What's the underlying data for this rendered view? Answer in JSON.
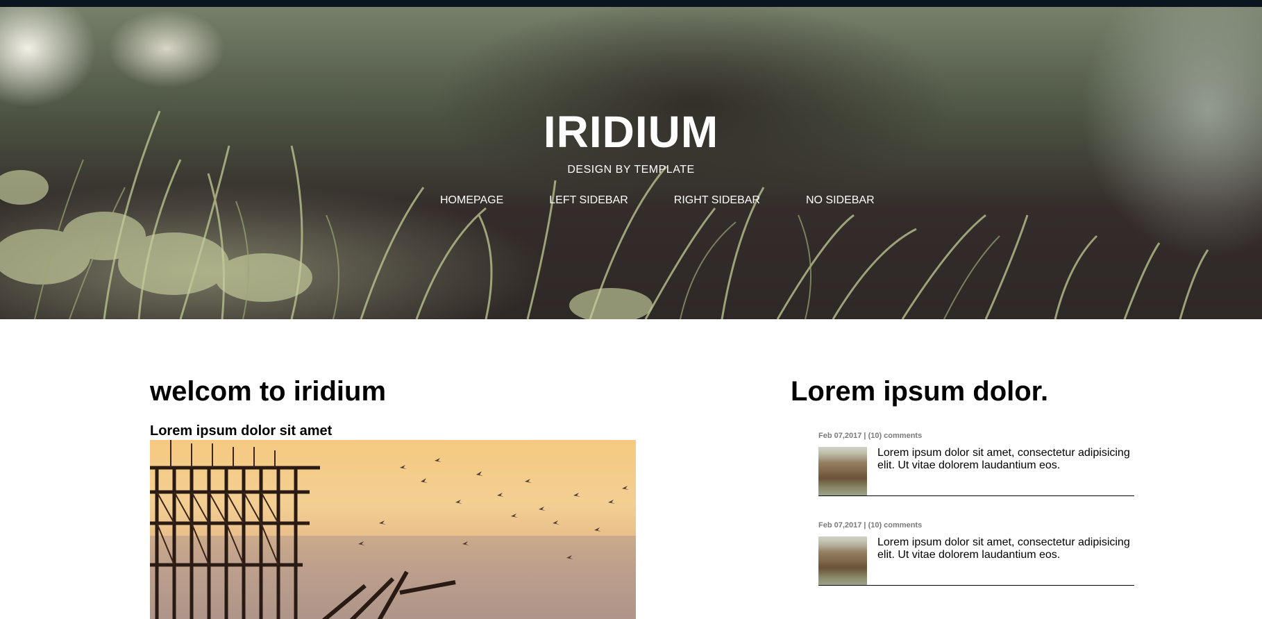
{
  "header": {
    "site_title": "IRIDIUM",
    "tagline": "DESIGN BY TEMPLATE",
    "nav": [
      {
        "label": "HOMEPAGE"
      },
      {
        "label": "LEFT SIDEBAR"
      },
      {
        "label": "RIGHT SIDEBAR"
      },
      {
        "label": "NO SIDEBAR"
      }
    ]
  },
  "main": {
    "heading": "welcom to iridium",
    "subheading": "Lorem ipsum dolor sit amet"
  },
  "sidebar": {
    "heading": "Lorem ipsum dolor.",
    "posts": [
      {
        "meta": "Feb 07,2017 | (10) comments",
        "text": "Lorem ipsum dolor sit amet, consectetur adipisicing elit. Ut vitae dolorem laudantium eos."
      },
      {
        "meta": "Feb 07,2017 | (10) comments",
        "text": "Lorem ipsum dolor sit amet, consectetur adipisicing elit. Ut vitae dolorem laudantium eos."
      }
    ]
  },
  "colors": {
    "text": "#000000",
    "meta": "#7a7a7a",
    "header_text": "#ffffff"
  }
}
